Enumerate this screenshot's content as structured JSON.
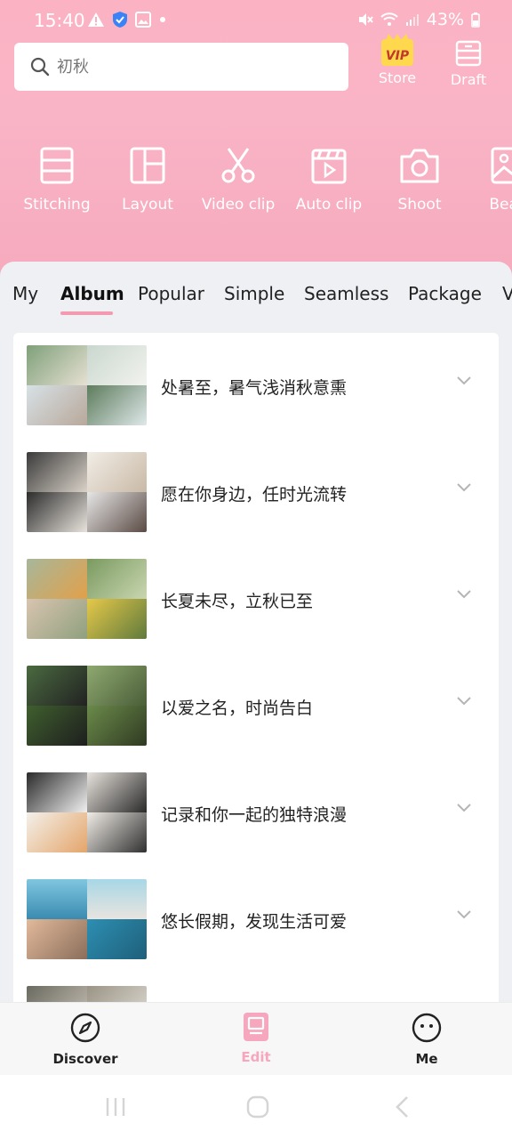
{
  "status_bar": {
    "time": "15:40",
    "battery": "43%"
  },
  "search": {
    "placeholder": "初秋"
  },
  "top_actions": {
    "vip_badge": "VIP",
    "store_label": "Store",
    "draft_label": "Draft"
  },
  "tools": [
    {
      "label": "Stitching",
      "icon": "stitching-icon"
    },
    {
      "label": "Layout",
      "icon": "layout-icon"
    },
    {
      "label": "Video clip",
      "icon": "scissors-icon"
    },
    {
      "label": "Auto clip",
      "icon": "clapper-icon"
    },
    {
      "label": "Shoot",
      "icon": "camera-icon"
    },
    {
      "label": "Beau",
      "icon": "image-icon"
    }
  ],
  "tabs": [
    {
      "label": "My",
      "active": false
    },
    {
      "label": "Album",
      "active": true
    },
    {
      "label": "Popular",
      "active": false
    },
    {
      "label": "Simple",
      "active": false
    },
    {
      "label": "Seamless",
      "active": false
    },
    {
      "label": "Package",
      "active": false
    },
    {
      "label": "V",
      "active": false
    }
  ],
  "templates": [
    {
      "title": "处暑至，暑气浅消秋意熏"
    },
    {
      "title": "愿在你身边，任时光流转"
    },
    {
      "title": "长夏未尽，立秋已至"
    },
    {
      "title": "以爱之名，时尚告白"
    },
    {
      "title": "记录和你一起的独特浪漫"
    },
    {
      "title": "悠长假期，发现生活可爱"
    }
  ],
  "bottom_nav": {
    "discover": "Discover",
    "edit": "Edit",
    "me": "Me"
  },
  "colors": {
    "header_pink": "#f9b4c6",
    "accent_pink": "#f39ab0",
    "panel_bg": "#eef0f4"
  }
}
